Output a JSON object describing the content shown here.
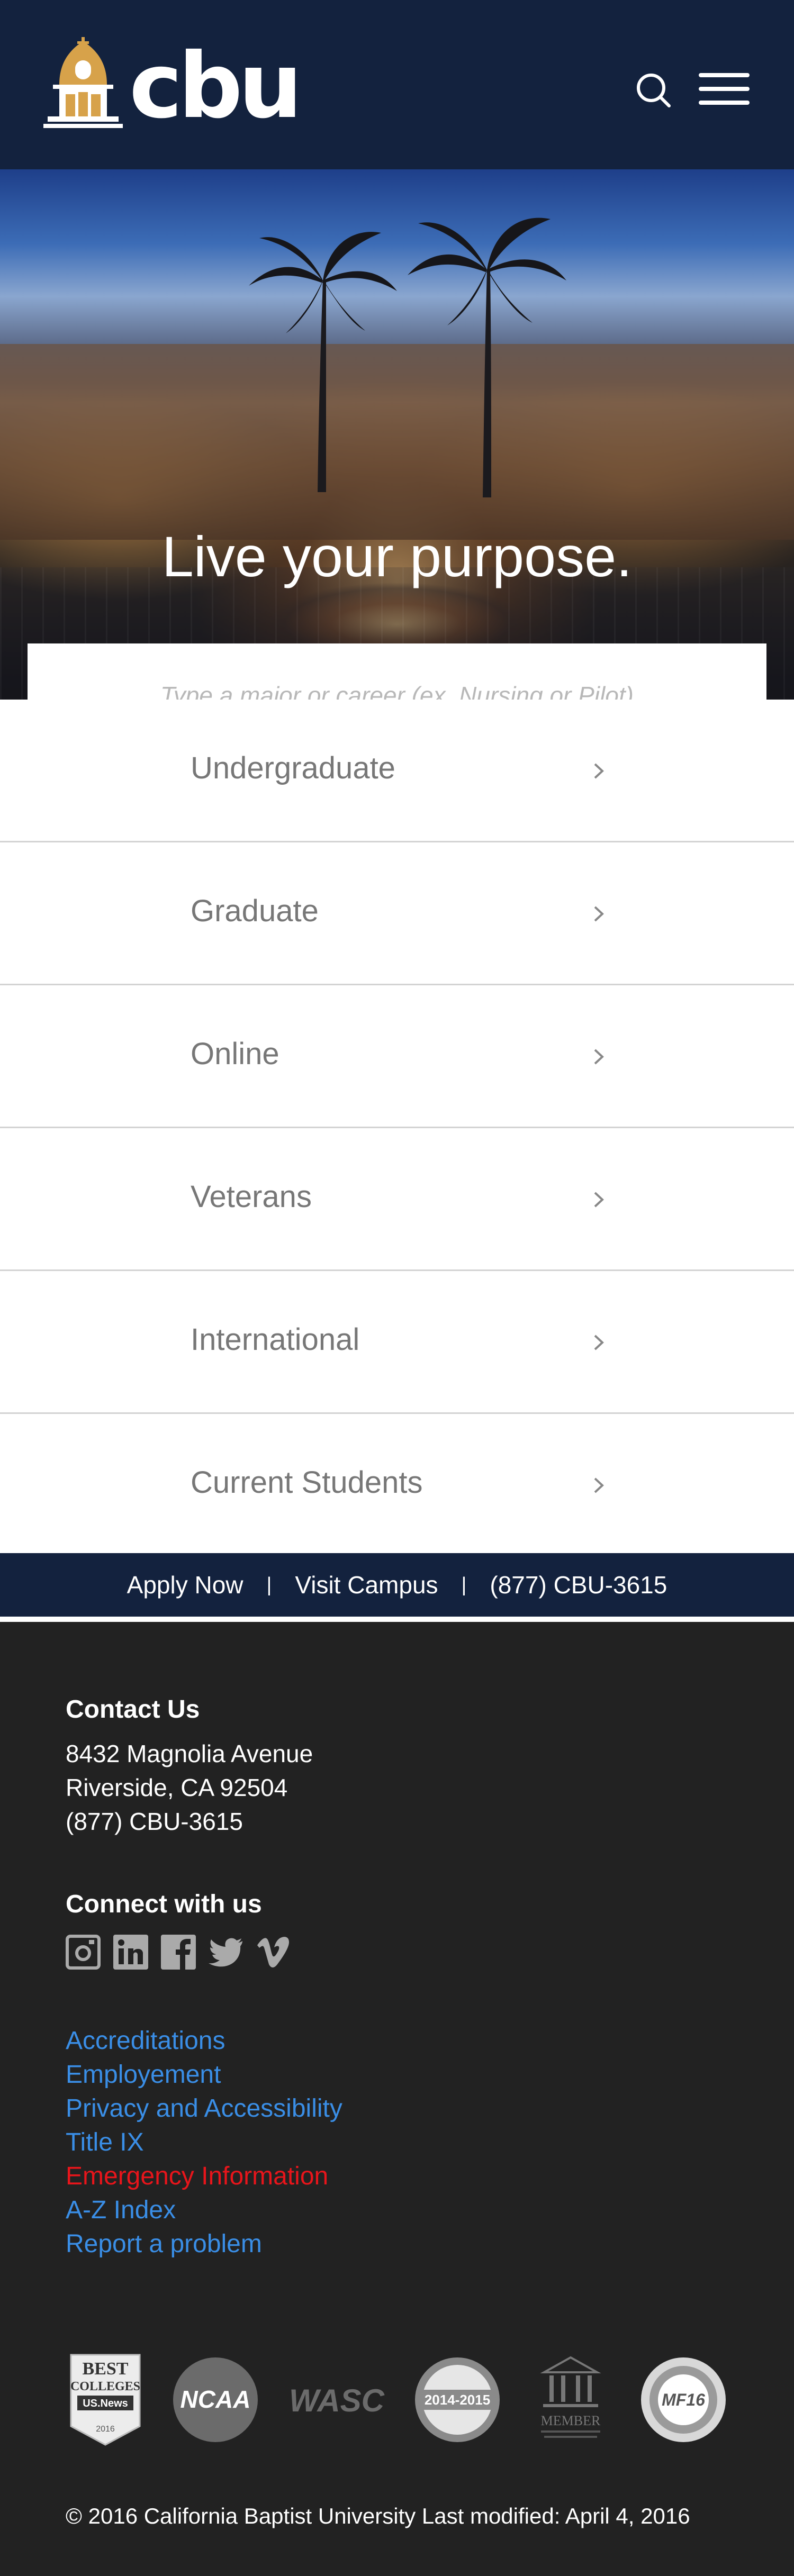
{
  "header": {
    "logo_text": "cbu"
  },
  "hero": {
    "title": "Live your purpose.",
    "search_placeholder": "Type a major or career (ex. Nursing or Pilot)"
  },
  "nav": {
    "items": [
      {
        "label": "Undergraduate"
      },
      {
        "label": "Graduate"
      },
      {
        "label": "Online"
      },
      {
        "label": "Veterans"
      },
      {
        "label": "International"
      },
      {
        "label": "Current Students"
      }
    ]
  },
  "cta": {
    "apply": "Apply Now",
    "separator": "|",
    "visit": "Visit Campus",
    "phone": "(877) CBU-3615"
  },
  "footer": {
    "contact_heading": "Contact Us",
    "address_line1": "8432 Magnolia Avenue",
    "address_line2": "Riverside, CA 92504",
    "phone": "(877) CBU-3615",
    "connect_heading": "Connect with us",
    "social_icons": [
      "instagram-icon",
      "linkedin-icon",
      "facebook-icon",
      "twitter-icon",
      "vimeo-icon"
    ],
    "links": [
      {
        "label": "Accreditations"
      },
      {
        "label": "Employement"
      },
      {
        "label": "Privacy and Accessibility"
      },
      {
        "label": "Title IX"
      },
      {
        "label": "Emergency Information"
      },
      {
        "label": "A-Z Index"
      },
      {
        "label": "Report a problem"
      }
    ],
    "badges": {
      "usnews_line1": "BEST",
      "usnews_line2": "COLLEGES",
      "usnews_line3": "US.News",
      "usnews_year": "2016",
      "ncaa": "NCAA",
      "wasc": "WASC",
      "excellence_years": "2014-2015",
      "cccu_member": "MEMBER",
      "military": "MF16"
    },
    "copyright": "© 2016 California Baptist University Last modified: April 4, 2016"
  },
  "colors": {
    "header_bg": "#13223e",
    "link_blue": "#3a8ee6",
    "emergency_red": "#e8151b",
    "footer_bg": "#222222",
    "logo_gold": "#d7a24a"
  }
}
